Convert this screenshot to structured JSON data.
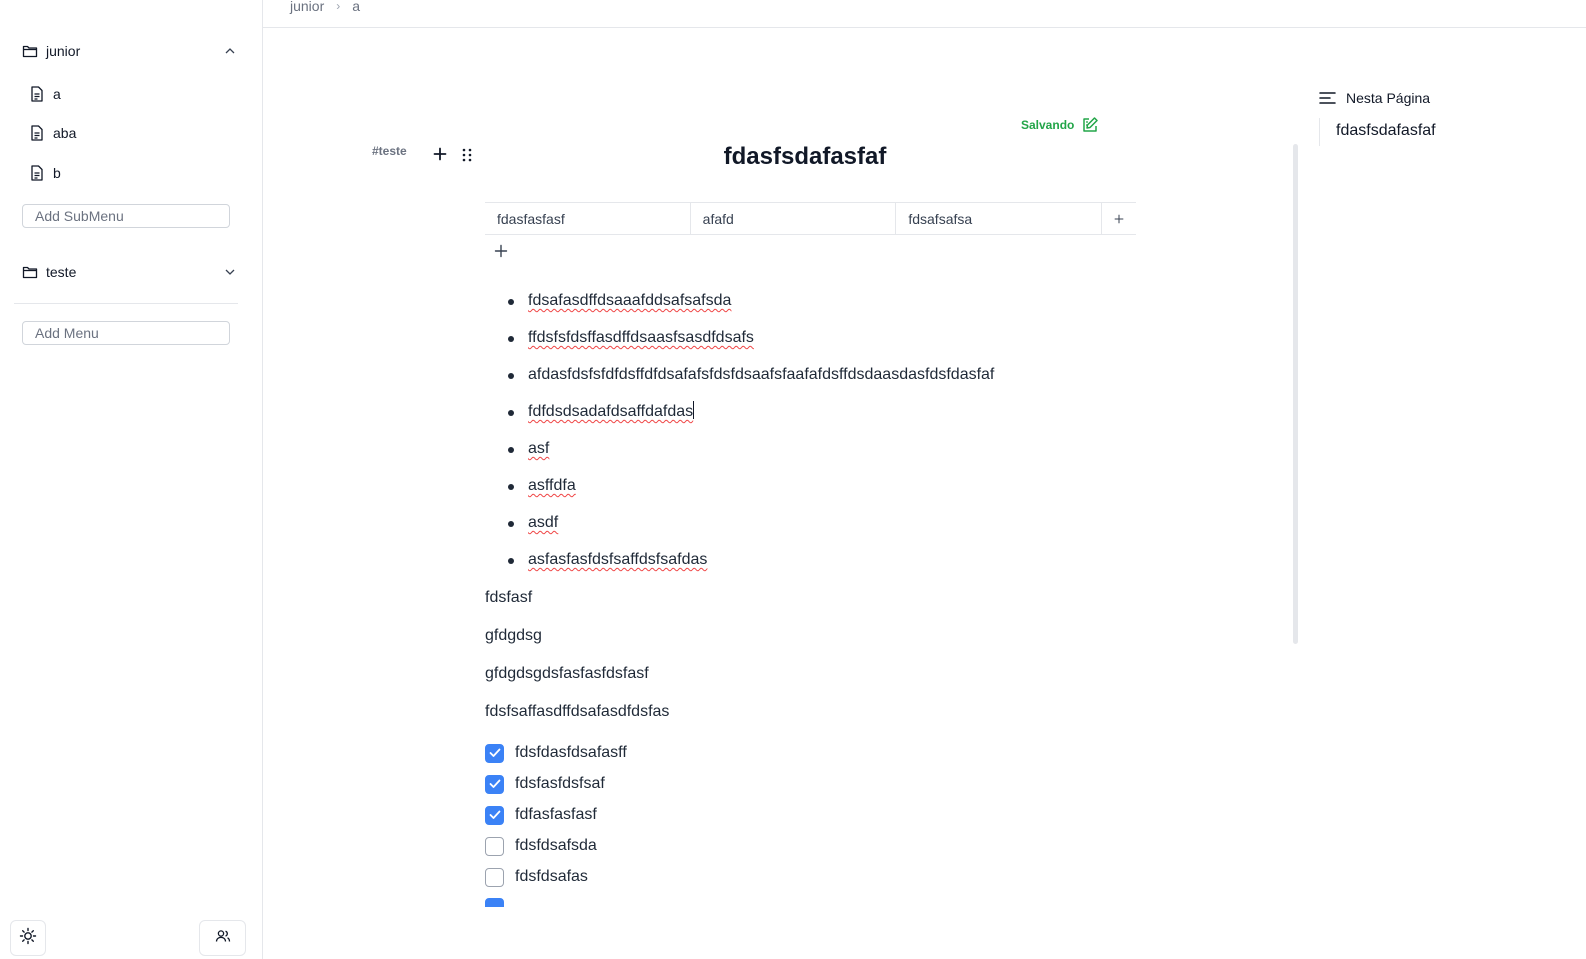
{
  "sidebar": {
    "folders": [
      {
        "label": "junior",
        "expanded": true,
        "icon": "folder-icon"
      },
      {
        "label": "teste",
        "expanded": false,
        "icon": "folder-icon"
      }
    ],
    "files": [
      {
        "label": "a",
        "icon": "file-icon"
      },
      {
        "label": "aba",
        "icon": "file-icon"
      },
      {
        "label": "b",
        "icon": "file-icon"
      }
    ],
    "add_submenu_placeholder": "Add SubMenu",
    "add_menu_placeholder": "Add Menu",
    "bottom": {
      "theme_icon": "sun-icon",
      "users_icon": "users-icon"
    }
  },
  "breadcrumb": {
    "items": [
      "junior",
      "a"
    ]
  },
  "editor": {
    "tag": "#teste",
    "status": "Salvando",
    "status_color": "#22a548",
    "title": "fdasfsdafasfaf",
    "table": {
      "cells": [
        "fdasfasfasf",
        "afafd",
        "fdsafsafsa"
      ]
    },
    "bullets": [
      "fdsafasdffdsaaafddsafsafsda",
      "ffdsfsfdsffasdffdsaasfsasdfdsafs",
      "afdasfdsfsfdfdsffdfdsafafsfdsfdsaafsfaafafdsffdsdaasdasfdsfdasfaf",
      "fdfdsdsadafdsaffdafdas",
      "asf",
      "asffdfa",
      "asdf",
      "asfasfasfdsfsaffdsfsafdas"
    ],
    "paragraphs": [
      "fdsfasf",
      "gfdgdsg",
      "gfdgdsgdsfasfasfdsfasf",
      "fdsfsaffasdffdsafasdfdsfas"
    ],
    "checklist": [
      {
        "label": "fdsfdasfdsafasff",
        "checked": true
      },
      {
        "label": "fdsfasfdsfsaf",
        "checked": true
      },
      {
        "label": "fdfasfasfasf",
        "checked": true
      },
      {
        "label": "fdsfdsafsda",
        "checked": false
      },
      {
        "label": "fdsfdsafas",
        "checked": false
      }
    ],
    "accent_color": "#3b82f6"
  },
  "toc": {
    "heading": "Nesta Página",
    "items": [
      "fdasfsdafasfaf"
    ]
  }
}
